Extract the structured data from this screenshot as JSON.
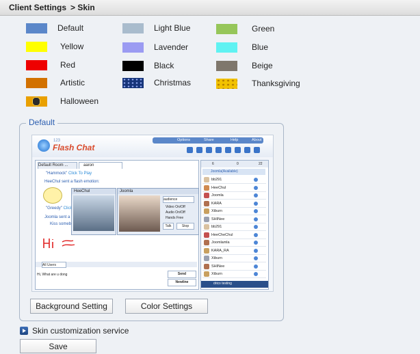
{
  "header": {
    "title": "Client Settings",
    "crumb": "> Skin"
  },
  "skins": [
    {
      "label": "Default",
      "color": "#5b87c9"
    },
    {
      "label": "Light Blue",
      "color": "#a9bccd"
    },
    {
      "label": "Green",
      "color": "#96c65a"
    },
    {
      "label": "Yellow",
      "color": "#ffff00"
    },
    {
      "label": "Lavender",
      "color": "#9b9bf2"
    },
    {
      "label": "Blue",
      "color": "#5ff2f2"
    },
    {
      "label": "Red",
      "color": "#ee0000"
    },
    {
      "label": "Black",
      "color": "#000000"
    },
    {
      "label": "Beige",
      "color": "#7f776c"
    },
    {
      "label": "Artistic",
      "color": "#d27100"
    },
    {
      "label": "Christmas",
      "color": "#17357a"
    },
    {
      "label": "Thanksgiving",
      "color": "#f2c200"
    },
    {
      "label": "Halloween",
      "color": "#e9a000"
    }
  ],
  "preview_group": {
    "legend": "Default"
  },
  "preview": {
    "logo_prefix": "123",
    "logo": "Flash Chat",
    "menu": [
      "Options",
      "Share",
      "Help",
      "About"
    ],
    "tab1": "Default Room ...",
    "tab2": "aaron",
    "msg1_name": "\"Hammock\"",
    "msg1_link": "Click To Play",
    "msg2": "HeeChul sent a flash emotion:",
    "msg3_name": "\"Greedy\"",
    "msg3_link": "Click",
    "msg4": "Joomla sent a",
    "msg5": "Kiss someb",
    "video1_name": "HeeChul",
    "video2_name": "Joomla",
    "audience": "audience",
    "opt1": "Video On/Off",
    "opt2": "Audio On/Off",
    "opt3": "Hands Free",
    "talk": "Talk",
    "stop": "Stop",
    "user_select": "All Users",
    "input_text": "Hi, What are u dong",
    "send": "Send",
    "newline": "Newline",
    "right_tabs": [
      "6",
      "0",
      "22"
    ],
    "room_title": "Joomla(Available)",
    "users": [
      "bb291",
      "HeeChul",
      "Joomla",
      "KARA",
      "Xiburn",
      "SHINee",
      "bb291",
      "HeeCheChul",
      "Joomlamla",
      "KARA_RA",
      "Xiburn",
      "SHINee",
      "Xiburn"
    ],
    "status_user": "drico testing"
  },
  "buttons": {
    "background": "Background Setting",
    "color": "Color Settings",
    "save": "Save"
  },
  "service_label": "Skin customization service"
}
